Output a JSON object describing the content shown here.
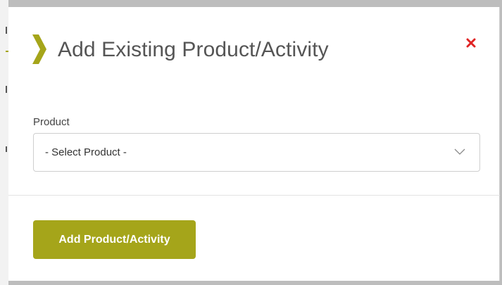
{
  "modal": {
    "title": "Add Existing Product/Activity",
    "title_icon": "chevron-right-icon",
    "close_icon": "close-icon"
  },
  "form": {
    "product_label": "Product",
    "product_select": {
      "selected": "- Select Product -",
      "icon": "chevron-down-icon"
    }
  },
  "footer": {
    "submit_label": "Add Product/Activity"
  },
  "colors": {
    "accent": "#a5a51a",
    "close": "#e02424",
    "title_text": "#555555",
    "border": "#cfcfcf"
  }
}
